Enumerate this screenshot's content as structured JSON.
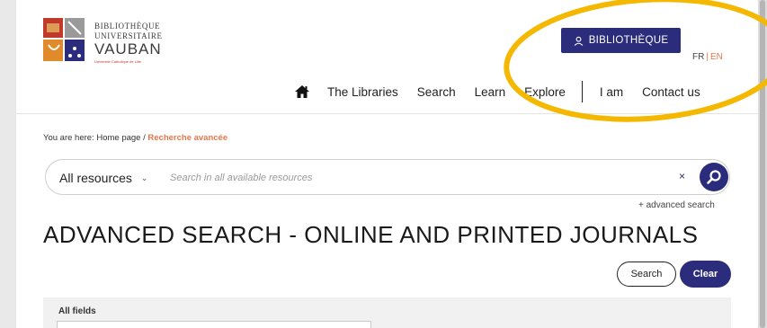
{
  "logo": {
    "line1": "Bibliothèque",
    "line2": "Universitaire",
    "line3": "VAUBAN",
    "line4": "Université Catholique de Lille"
  },
  "header": {
    "account_button": "BIBLIOTHÈQUE",
    "lang_fr": "FR",
    "lang_sep": "|",
    "lang_en": "EN"
  },
  "nav": {
    "items": [
      "The Libraries",
      "Search",
      "Learn",
      "Explore"
    ],
    "i_am": "I am",
    "contact": "Contact us"
  },
  "breadcrumb": {
    "prefix": "You are here:",
    "home": "Home page",
    "sep": "/",
    "current": "Recherche avancée"
  },
  "search": {
    "scope": "All resources",
    "placeholder": "Search in all available resources",
    "value": "",
    "clear": "×",
    "advanced_link": "+ advanced search"
  },
  "page": {
    "title": "ADVANCED SEARCH - ONLINE AND PRINTED JOURNALS",
    "search_button": "Search",
    "clear_button": "Clear",
    "fields_label": "All fields"
  },
  "colors": {
    "brand": "#2b2d7c",
    "accent": "#e8764b",
    "highlight": "#f5b800"
  }
}
